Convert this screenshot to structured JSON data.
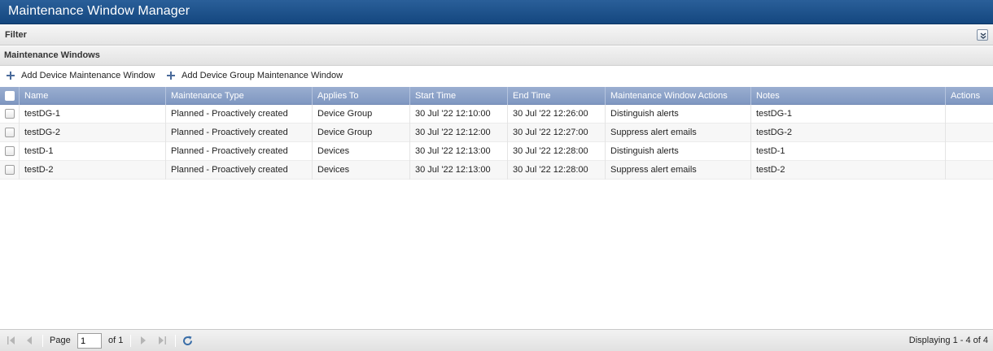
{
  "app": {
    "title": "Maintenance Window Manager"
  },
  "filter": {
    "label": "Filter"
  },
  "panel": {
    "title": "Maintenance Windows"
  },
  "toolbar": {
    "add_device_label": "Add Device Maintenance Window",
    "add_group_label": "Add Device Group Maintenance Window"
  },
  "table": {
    "columns": [
      "Name",
      "Maintenance Type",
      "Applies To",
      "Start Time",
      "End Time",
      "Maintenance Window Actions",
      "Notes",
      "Actions"
    ],
    "rows": [
      [
        "testDG-1",
        "Planned - Proactively created",
        "Device Group",
        "30 Jul '22 12:10:00",
        "30 Jul '22 12:26:00",
        "Distinguish alerts",
        "testDG-1",
        ""
      ],
      [
        "testDG-2",
        "Planned - Proactively created",
        "Device Group",
        "30 Jul '22 12:12:00",
        "30 Jul '22 12:27:00",
        "Suppress alert emails",
        "testDG-2",
        ""
      ],
      [
        "testD-1",
        "Planned - Proactively created",
        "Devices",
        "30 Jul '22 12:13:00",
        "30 Jul '22 12:28:00",
        "Distinguish alerts",
        "testD-1",
        ""
      ],
      [
        "testD-2",
        "Planned - Proactively created",
        "Devices",
        "30 Jul '22 12:13:00",
        "30 Jul '22 12:28:00",
        "Suppress alert emails",
        "testD-2",
        ""
      ]
    ]
  },
  "pager": {
    "page_label": "Page",
    "page_value": "1",
    "of_label": "of 1",
    "display_text": "Displaying 1 - 4 of 4"
  },
  "colors": {
    "title_bar": "#1d518b",
    "grid_header": "#8aa0c8"
  }
}
